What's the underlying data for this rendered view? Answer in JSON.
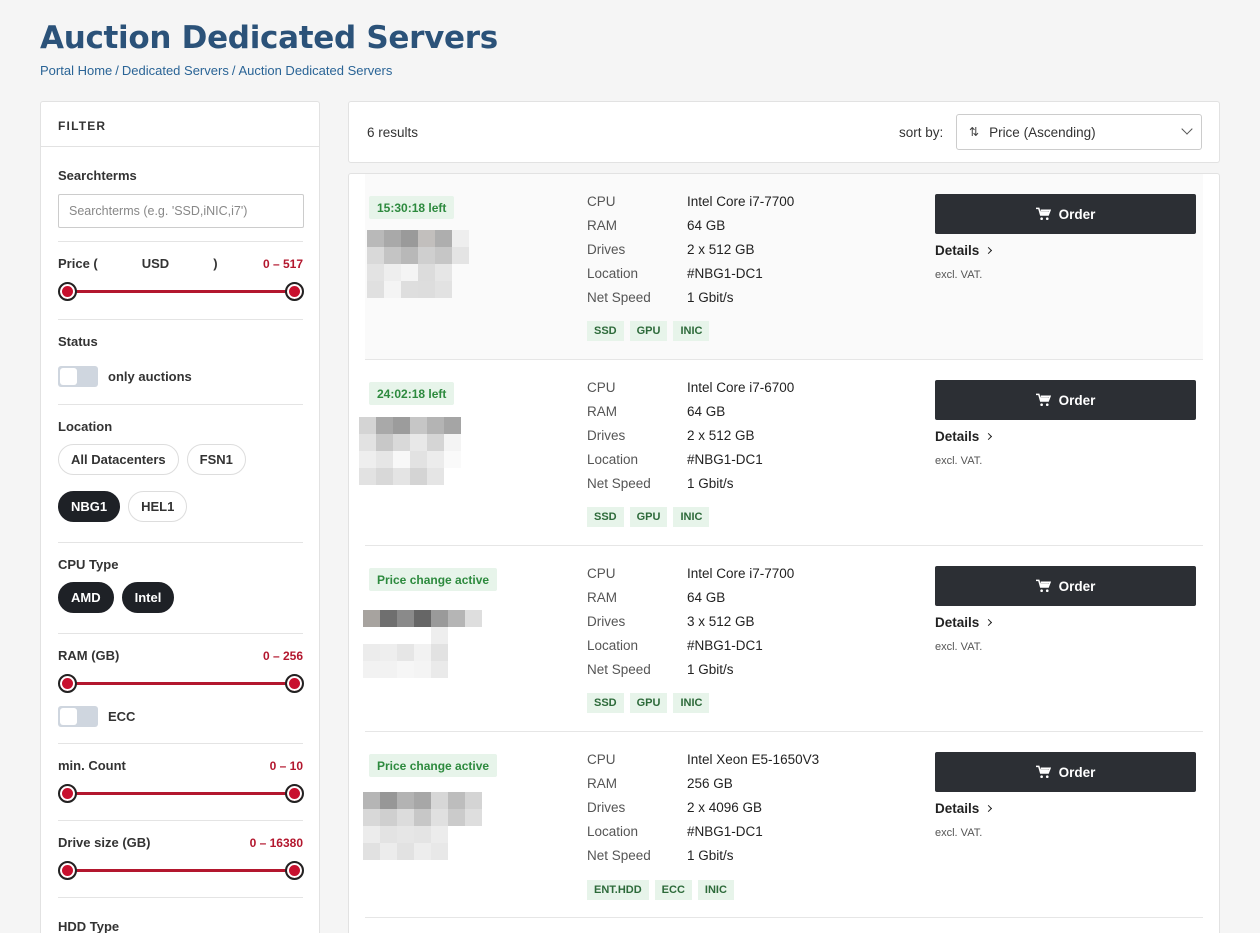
{
  "page": {
    "title": "Auction Dedicated Servers",
    "breadcrumb": [
      "Portal Home",
      "Dedicated Servers",
      "Auction Dedicated Servers"
    ]
  },
  "filter": {
    "header": "FILTER",
    "searchterms_label": "Searchterms",
    "searchterms_placeholder": "Searchterms (e.g. 'SSD,iNIC,i7')",
    "price_label": "Price (",
    "price_currency": "USD",
    "price_close": ")",
    "price_range": "0 – 517",
    "status_label": "Status",
    "only_auctions_label": "only auctions",
    "location_label": "Location",
    "locations": [
      {
        "label": "All Datacenters",
        "active": false
      },
      {
        "label": "FSN1",
        "active": false
      },
      {
        "label": "NBG1",
        "active": true
      },
      {
        "label": "HEL1",
        "active": false
      }
    ],
    "cpu_type_label": "CPU Type",
    "cpu_types": [
      {
        "label": "AMD",
        "active": true
      },
      {
        "label": "Intel",
        "active": true
      }
    ],
    "ram_label": "RAM (GB)",
    "ram_range": "0 – 256",
    "ecc_label": "ECC",
    "min_count_label": "min. Count",
    "min_count_range": "0 – 10",
    "drive_size_label": "Drive size (GB)",
    "drive_size_range": "0 – 16380",
    "hdd_type_label": "HDD Type"
  },
  "results": {
    "count_text": "6 results",
    "sort_label": "sort by:",
    "sort_value": "Price (Ascending)"
  },
  "spec_labels": {
    "cpu": "CPU",
    "ram": "RAM",
    "drives": "Drives",
    "location": "Location",
    "net_speed": "Net Speed"
  },
  "actions": {
    "order": "Order",
    "details": "Details",
    "vat": "excl. VAT."
  },
  "colors": {
    "title": "#2b5279",
    "accent_red": "#b3172e",
    "badge_green": "#2d8a3e",
    "button_dark": "#2c2f34"
  },
  "servers": [
    {
      "badge": "15:30:18 left",
      "cpu": "Intel Core i7-7700",
      "ram": "64 GB",
      "drives": "2 x 512 GB",
      "location": "#NBG1-DC1",
      "net_speed": "1 Gbit/s",
      "tags": [
        "SSD",
        "GPU",
        "INIC"
      ]
    },
    {
      "badge": "24:02:18 left",
      "cpu": "Intel Core i7-6700",
      "ram": "64 GB",
      "drives": "2 x 512 GB",
      "location": "#NBG1-DC1",
      "net_speed": "1 Gbit/s",
      "tags": [
        "SSD",
        "GPU",
        "INIC"
      ]
    },
    {
      "badge": "Price change active",
      "cpu": "Intel Core i7-7700",
      "ram": "64 GB",
      "drives": "3 x 512 GB",
      "location": "#NBG1-DC1",
      "net_speed": "1 Gbit/s",
      "tags": [
        "SSD",
        "GPU",
        "INIC"
      ]
    },
    {
      "badge": "Price change active",
      "cpu": "Intel Xeon E5-1650V3",
      "ram": "256 GB",
      "drives": "2 x 4096 GB",
      "location": "#NBG1-DC1",
      "net_speed": "1 Gbit/s",
      "tags": [
        "ENT.HDD",
        "ECC",
        "INIC"
      ]
    }
  ]
}
